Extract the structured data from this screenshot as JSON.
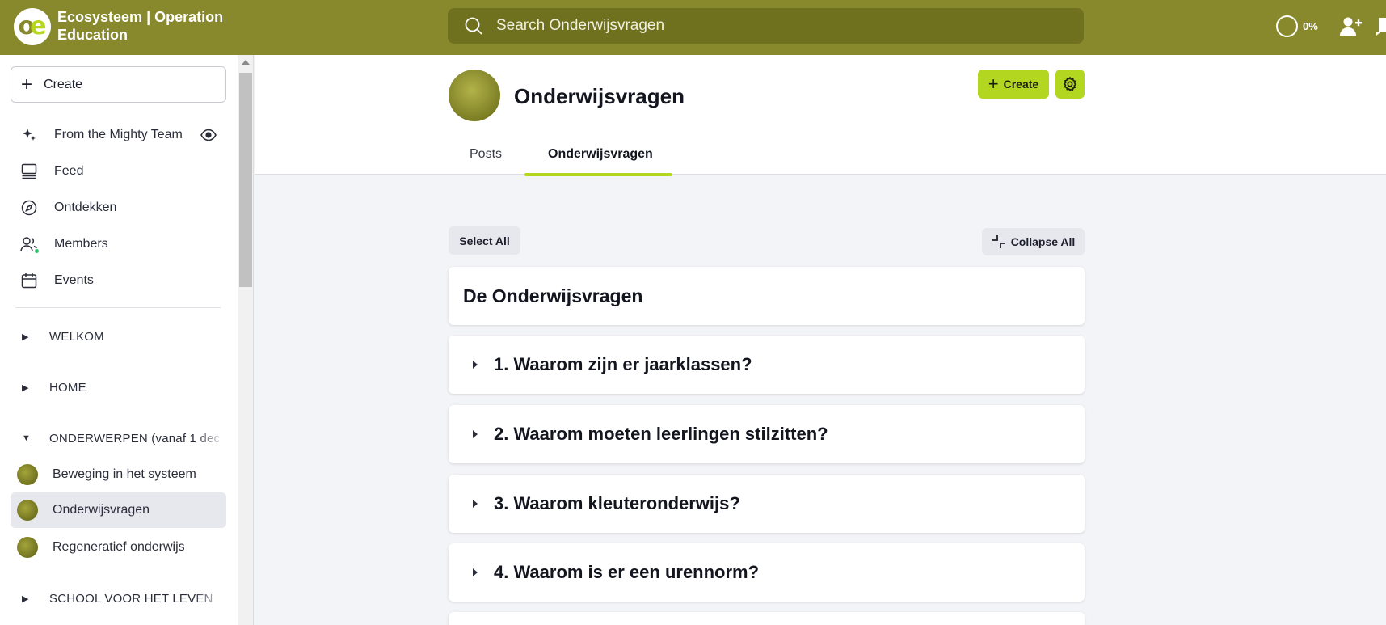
{
  "app": {
    "title": "Ecosysteem | Operation Education",
    "logo_text_o": "o",
    "logo_text_e": "e",
    "brand_color": "#88892d",
    "accent_color": "#b3d721"
  },
  "search": {
    "placeholder": "Search Onderwijsvragen"
  },
  "progress": {
    "label": "0%"
  },
  "sidebar": {
    "create_label": "Create",
    "items": [
      {
        "label": "From the Mighty Team",
        "icon": "sparkle-icon"
      },
      {
        "label": "Feed",
        "icon": "feed-icon"
      },
      {
        "label": "Ontdekken",
        "icon": "compass-icon"
      },
      {
        "label": "Members",
        "icon": "members-icon"
      },
      {
        "label": "Events",
        "icon": "calendar-icon"
      }
    ],
    "sections": [
      {
        "label": "WELKOM",
        "expanded": false
      },
      {
        "label": "HOME",
        "expanded": false
      },
      {
        "label": "ONDERWERPEN (vanaf 1 dec",
        "expanded": true
      },
      {
        "label": "SCHOOL VOOR HET LEVEN",
        "expanded": false
      }
    ],
    "spaces": [
      {
        "label": "Beweging in het systeem"
      },
      {
        "label": "Onderwijsvragen",
        "active": true
      },
      {
        "label": "Regeneratief onderwijs"
      }
    ]
  },
  "space": {
    "title": "Onderwijsvragen",
    "create_label": "Create",
    "tabs": [
      {
        "label": "Posts"
      },
      {
        "label": "Onderwijsvragen",
        "active": true
      }
    ]
  },
  "content": {
    "select_all_label": "Select All",
    "collapse_all_label": "Collapse All",
    "heading": "De Onderwijsvragen",
    "items": [
      {
        "title": "1. Waarom zijn er jaarklassen?"
      },
      {
        "title": "2. Waarom moeten leerlingen stilzitten?"
      },
      {
        "title": "3. Waarom kleuteronderwijs?"
      },
      {
        "title": "4. Waarom is er een urennorm?"
      }
    ]
  }
}
